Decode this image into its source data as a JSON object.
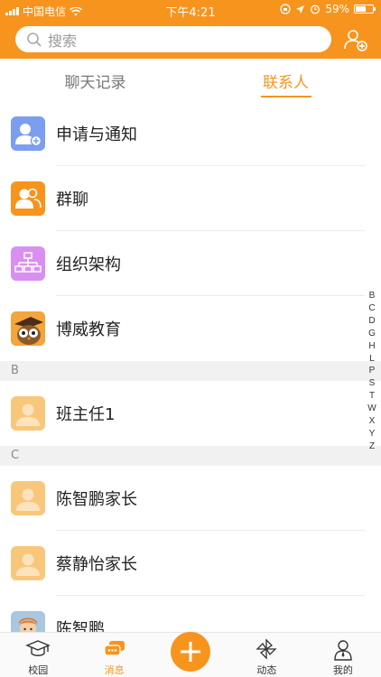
{
  "status_bar": {
    "carrier": "中国电信",
    "time": "下午4:21",
    "battery": "59%",
    "battery_level": 0.59
  },
  "header": {
    "search_placeholder": "搜索",
    "add_contact_icon": "add-contact-icon"
  },
  "tabs": [
    {
      "label": "聊天记录",
      "active": false
    },
    {
      "label": "联系人",
      "active": true
    }
  ],
  "entries": [
    {
      "label": "申请与通知",
      "icon": "add-user-icon",
      "color": "#7b9ef0"
    },
    {
      "label": "群聊",
      "icon": "group-icon",
      "color": "#f7941e"
    },
    {
      "label": "组织架构",
      "icon": "org-chart-icon",
      "color": "#d98ff0"
    },
    {
      "label": "博威教育",
      "icon": "brand-owl-icon",
      "color": "#f4a53b"
    }
  ],
  "sections": [
    {
      "letter": "B",
      "contacts": [
        {
          "name": "班主任1"
        }
      ]
    },
    {
      "letter": "C",
      "contacts": [
        {
          "name": "陈智鹏家长"
        },
        {
          "name": "蔡静怡家长"
        },
        {
          "name": "陈智鹏"
        }
      ]
    }
  ],
  "index_letters": [
    "B",
    "C",
    "D",
    "G",
    "H",
    "L",
    "P",
    "S",
    "T",
    "W",
    "X",
    "Y",
    "Z"
  ],
  "tabbar": [
    {
      "label": "校园",
      "icon": "graduation-cap-icon",
      "active": false
    },
    {
      "label": "消息",
      "icon": "chat-bubbles-icon",
      "active": true
    },
    {
      "label": "",
      "icon": "plus-icon",
      "active": false
    },
    {
      "label": "动态",
      "icon": "pinwheel-icon",
      "active": false
    },
    {
      "label": "我的",
      "icon": "person-icon",
      "active": false
    }
  ],
  "colors": {
    "accent": "#f7941e",
    "section_bg": "#f1f1f1"
  }
}
